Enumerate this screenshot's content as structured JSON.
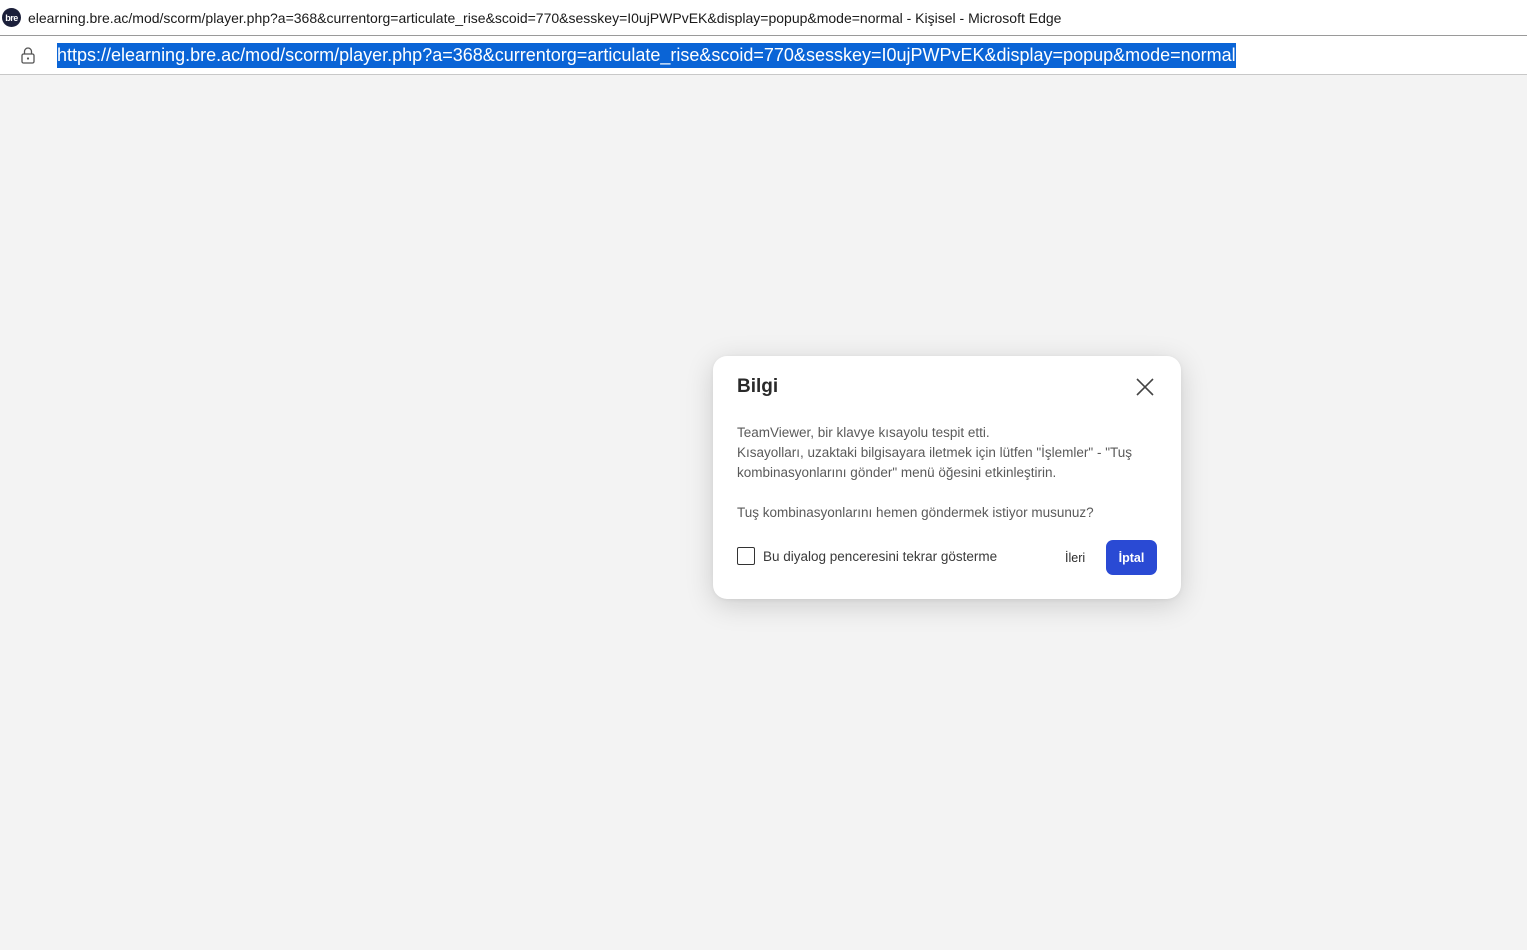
{
  "window": {
    "title": "elearning.bre.ac/mod/scorm/player.php?a=368&currentorg=articulate_rise&scoid=770&sesskey=I0ujPWPvEK&display=popup&mode=normal - Kişisel - Microsoft Edge",
    "site_logo_text": "bre"
  },
  "address_bar": {
    "url": "https://elearning.bre.ac/mod/scorm/player.php?a=368&currentorg=articulate_rise&scoid=770&sesskey=I0ujPWPvEK&display=popup&mode=normal",
    "lock_icon": "lock-icon",
    "selection_color": "#0a64d6"
  },
  "dialog": {
    "title": "Bilgi",
    "close_icon": "close-icon",
    "body_line1": "TeamViewer, bir klavye kısayolu tespit etti.",
    "body_line2": "Kısayolları, uzaktaki bilgisayara iletmek için lütfen \"İşlemler\" - \"Tuş kombinasyonlarını gönder\" menü öğesini etkinleştirin.",
    "body_question": "Tuş kombinasyonlarını hemen göndermek istiyor musunuz?",
    "checkbox_label": "Bu diyalog penceresini tekrar gösterme",
    "checkbox_checked": false,
    "next_button": "İleri",
    "cancel_button": "İptal",
    "accent_color": "#2a4ad4"
  }
}
